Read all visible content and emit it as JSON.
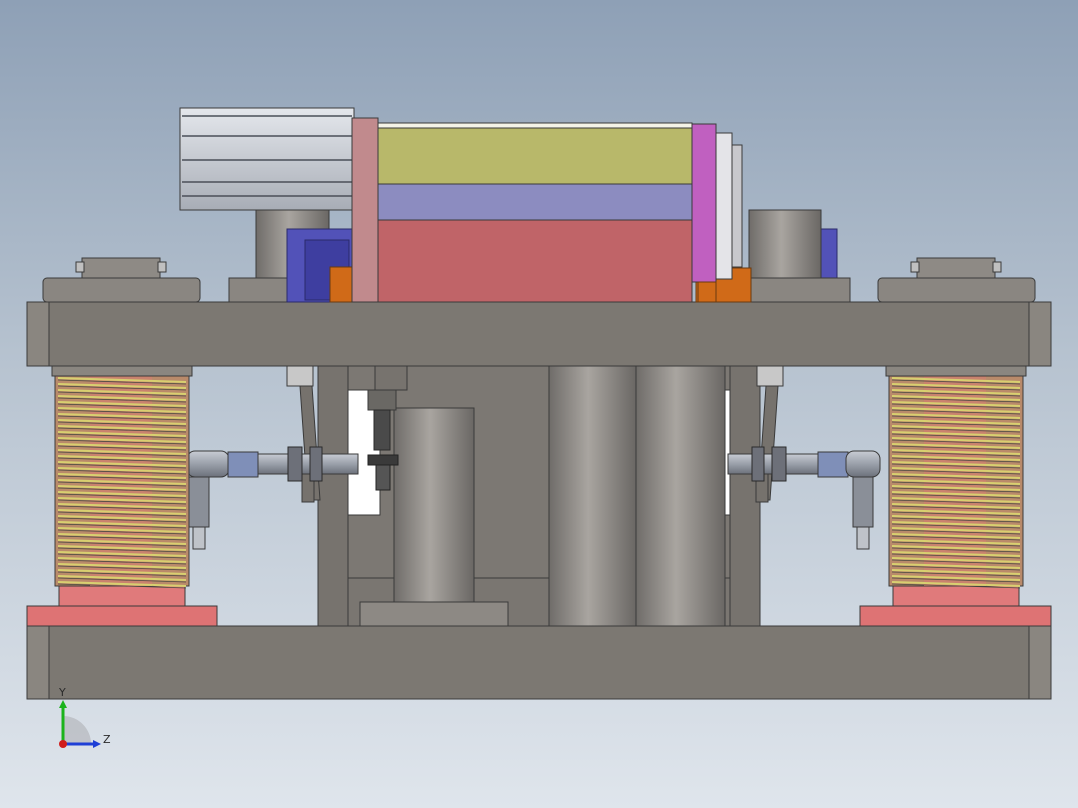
{
  "viewport": {
    "background_top": "#8ea0b6",
    "background_bottom": "#dfe5ec"
  },
  "triad": {
    "y_label": "Y",
    "z_label": "Z",
    "y_color": "#1bb31b",
    "z_color": "#1f3fd6",
    "x_color": "#d01c1c"
  },
  "model": {
    "plate_color": "#7c7872",
    "edge_color": "#3a3a3a",
    "base_ring_color": "#de7374",
    "spring_color": "#d8d070",
    "top_block_color": "#b8b86a",
    "mid_block_color": "#8c8cc0",
    "red_block_color": "#c06468",
    "magenta_plate_color": "#c060c0",
    "blue_block_color": "#5252b8",
    "orange_block_color": "#d06a18"
  }
}
